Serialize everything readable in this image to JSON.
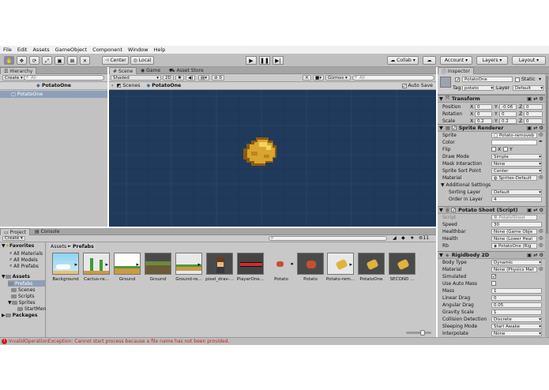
{
  "menu": [
    "File",
    "Edit",
    "Assets",
    "GameObject",
    "Component",
    "Window",
    "Help"
  ],
  "toolbar": {
    "center": "Center",
    "local": "Local",
    "collab": "Collab",
    "account": "Account",
    "layers": "Layers",
    "layout": "Layout"
  },
  "hierarchy": {
    "tab": "Hierarchy",
    "create": "Create",
    "search": "All",
    "scene": "PotatoOne",
    "item": "PotatoOne"
  },
  "scene": {
    "tab_scene": "Scene",
    "tab_game": "Game",
    "tab_store": "Asset Store",
    "shaded": "Shaded",
    "mode2d": "2D",
    "gizmos": "Gizmos",
    "search": "All",
    "crumb_scenes": "Scenes",
    "crumb_obj": "PotatoOne",
    "autosave": "Auto Save"
  },
  "inspector": {
    "tab": "Inspector",
    "name": "PotatoOne",
    "static": "Static",
    "tag_label": "Tag",
    "tag": "potato",
    "layer_label": "Layer",
    "layer": "Default",
    "transform": {
      "title": "Transform",
      "rows": [
        {
          "label": "Position",
          "x": "0",
          "y": "-0.06",
          "z": "0"
        },
        {
          "label": "Rotation",
          "x": "0",
          "y": "0",
          "z": "0"
        },
        {
          "label": "Scale",
          "x": "0.2",
          "y": "0.2",
          "z": "0"
        }
      ]
    },
    "sprite_renderer": {
      "title": "Sprite Renderer",
      "sprite_label": "Sprite",
      "sprite": "Potato-removeb",
      "color_label": "Color",
      "flip_label": "Flip",
      "flip_x": "X",
      "flip_y": "Y",
      "draw_mode_label": "Draw Mode",
      "draw_mode": "Simple",
      "mask_label": "Mask Interaction",
      "mask": "None",
      "sort_point_label": "Sprite Sort Point",
      "sort_point": "Center",
      "material_label": "Material",
      "material": "Sprites-Default",
      "additional": "Additional Settings",
      "sorting_layer_label": "Sorting Layer",
      "sorting_layer": "Default",
      "order_label": "Order in Layer",
      "order": "4"
    },
    "potato_shoot": {
      "title": "Potato Shoot (Script)",
      "script_label": "Script",
      "script": "PotatoShoot",
      "speed_label": "Speed",
      "speed": "30",
      "healthbar_label": "Healthbar",
      "healthbar": "None (Game Obje",
      "health_label": "Health",
      "health": "None (Lower Heal",
      "rb_label": "Rb",
      "rb": "PotatoOne (Rig"
    },
    "rigidbody": {
      "title": "Rigidbody 2D",
      "rows": [
        {
          "label": "Body Type",
          "value": "Dynamic"
        },
        {
          "label": "Material",
          "value": "None (Physics Mat"
        },
        {
          "label": "Simulated",
          "value": ""
        },
        {
          "label": "Use Auto Mass",
          "value": ""
        },
        {
          "label": "Mass",
          "value": "1"
        },
        {
          "label": "Linear Drag",
          "value": "0"
        },
        {
          "label": "Angular Drag",
          "value": "0.05"
        },
        {
          "label": "Gravity Scale",
          "value": "1"
        },
        {
          "label": "Collision Detection",
          "value": "Discrete"
        },
        {
          "label": "Sleeping Mode",
          "value": "Start Awake"
        },
        {
          "label": "Interpolate",
          "value": "None"
        }
      ]
    }
  },
  "project": {
    "tab_project": "Project",
    "tab_console": "Console",
    "create": "Create",
    "count": "11",
    "breadcrumb_root": "Assets",
    "breadcrumb_sep": "►",
    "breadcrumb_leaf": "Prefabs",
    "favorites": "Favorites",
    "fav_items": [
      "All Materials",
      "All Models",
      "All Prefabs"
    ],
    "assets_root": "Assets",
    "asset_folders": [
      "Prefabs",
      "Scenes",
      "Scripts",
      "Sprites",
      "StartMen"
    ],
    "packages": "Packages",
    "assets": [
      {
        "label": "Background"
      },
      {
        "label": "Cactus-re..."
      },
      {
        "label": "Ground"
      },
      {
        "label": "Ground"
      },
      {
        "label": "Ground-re..."
      },
      {
        "label": "pixel_drav-..."
      },
      {
        "label": "PlayerOne..."
      },
      {
        "label": "Potato"
      },
      {
        "label": "Potato"
      },
      {
        "label": "Potato-rem..."
      },
      {
        "label": "PotatoOne"
      },
      {
        "label": "SECOND ..."
      }
    ]
  },
  "status": {
    "message": "InvalidOperationException: Cannot start process because a file name has not been provided."
  },
  "colors": {
    "scene_bg": "#203a5c",
    "selection": "#8e9fb8",
    "potato": "#e0b43a",
    "error": "#c8201e"
  }
}
